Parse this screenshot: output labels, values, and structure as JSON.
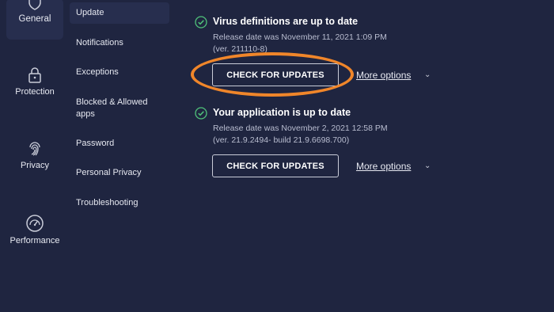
{
  "rail": {
    "items": [
      {
        "label": "General",
        "icon": "shield-icon",
        "active": true
      },
      {
        "label": "Protection",
        "icon": "lock-icon",
        "active": false
      },
      {
        "label": "Privacy",
        "icon": "fingerprint-icon",
        "active": false
      },
      {
        "label": "Performance",
        "icon": "speedometer-icon",
        "active": false
      }
    ]
  },
  "subnav": {
    "items": [
      {
        "label": "Update",
        "active": true
      },
      {
        "label": "Notifications"
      },
      {
        "label": "Exceptions"
      },
      {
        "label": "Blocked & Allowed apps"
      },
      {
        "label": "Password"
      },
      {
        "label": "Personal Privacy"
      },
      {
        "label": "Troubleshooting"
      }
    ]
  },
  "virus": {
    "title": "Virus definitions are up to date",
    "release": "Release date was November 11, 2021 1:09 PM",
    "version": "(ver. 211110-8)",
    "button": "CHECK FOR UPDATES",
    "more": "More options"
  },
  "app": {
    "title": "Your application is up to date",
    "release": "Release date was November 2, 2021 12:58 PM",
    "version": "(ver. 21.9.2494- build 21.9.6698.700)",
    "button": "CHECK FOR UPDATES",
    "more": "More options"
  },
  "colors": {
    "background": "#1f2540",
    "active_bg": "#272e4e",
    "success": "#4fc27a",
    "highlight": "#f0862a"
  }
}
